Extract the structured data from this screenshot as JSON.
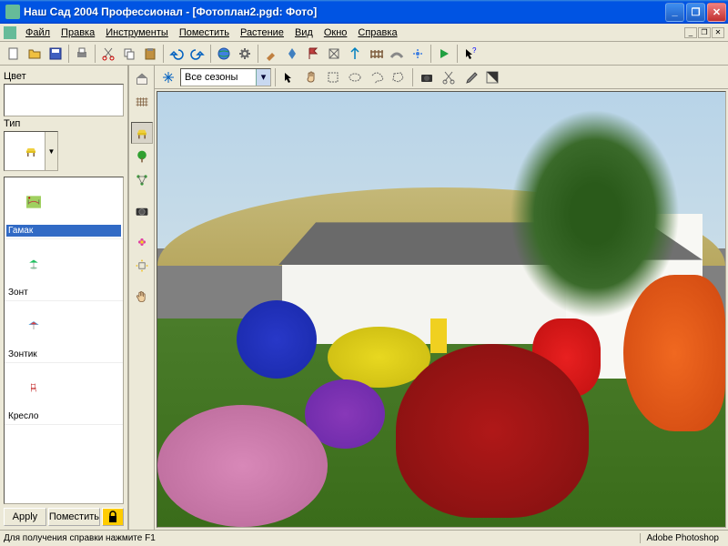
{
  "window": {
    "title": "Наш Сад 2004 Профессионал - [Фотоплан2.pgd: Фото]"
  },
  "menu": {
    "file": "Файл",
    "edit": "Правка",
    "tools": "Инструменты",
    "place": "Поместить",
    "plant": "Растение",
    "view": "Вид",
    "window": "Окно",
    "help": "Справка"
  },
  "left_panel": {
    "color_label": "Цвет",
    "type_label": "Тип",
    "items": [
      {
        "label": "Гамак"
      },
      {
        "label": "Зонт"
      },
      {
        "label": "Зонтик"
      },
      {
        "label": "Кресло"
      }
    ],
    "apply_btn": "Apply",
    "place_btn": "Поместить"
  },
  "sub_toolbar": {
    "season": "Все сезоны"
  },
  "statusbar": {
    "help": "Для получения справки нажмите F1",
    "app": "Adobe Photoshop"
  },
  "colors": {
    "xp_blue": "#0054e3",
    "bg": "#ece9d8"
  }
}
